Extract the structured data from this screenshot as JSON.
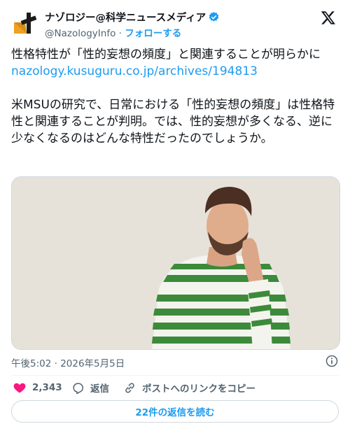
{
  "author": {
    "name": "ナゾロジー@科学ニュースメディア",
    "handle": "@NazologyInfo",
    "separator": "·",
    "follow_label": "フォローする"
  },
  "tweet": {
    "line1": "性格特性が「性的妄想の頻度」と関連することが明らかに",
    "link": "nazology.kusuguru.co.jp/archives/194813",
    "paragraph2": "米MSUの研究で、日常における「性的妄想の頻度」は性格特性と関連することが判明。では、性的妄想が多くなる、逆に少なくなるのはどんな特性だったのでしょうか。"
  },
  "timestamp": "午後5:02 · 2026年5月5日",
  "actions": {
    "like_count": "2,343",
    "reply_label": "返信",
    "copy_link_label": "ポストへのリンクをコピー"
  },
  "read_replies_label": "22件の返信を読む",
  "colors": {
    "accent": "#1d9bf0",
    "like": "#f91880",
    "text": "#0f1419",
    "muted": "#536471"
  },
  "icons": [
    "brand-logo-icon",
    "verified-badge-icon",
    "x-logo-icon",
    "info-icon",
    "heart-icon",
    "reply-icon",
    "link-icon"
  ]
}
